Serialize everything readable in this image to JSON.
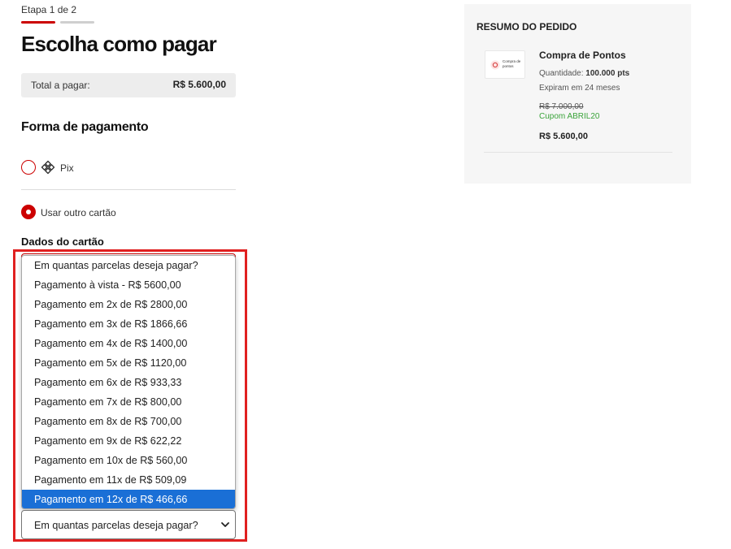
{
  "header": {
    "step_label": "Etapa 1 de 2",
    "steps_completed": 1,
    "steps_total": 2,
    "title": "Escolha como pagar"
  },
  "total": {
    "label": "Total a pagar:",
    "value": "R$ 5.600,00"
  },
  "payment": {
    "section_title": "Forma de pagamento",
    "options": [
      {
        "label": "Pix",
        "icon": "pix-icon",
        "checked": false
      },
      {
        "label": "Usar outro cartão",
        "checked": true
      }
    ]
  },
  "card": {
    "section_title": "Dados do cartão",
    "installments": {
      "placeholder": "Em quantas parcelas deseja pagar?",
      "selected_value": "Em quantas parcelas deseja pagar?",
      "highlighted_index": 12,
      "options": [
        "Em quantas parcelas deseja pagar?",
        "Pagamento à vista - R$ 5600,00",
        "Pagamento em 2x de R$ 2800,00",
        "Pagamento em 3x de R$ 1866,66",
        "Pagamento em 4x de R$ 1400,00",
        "Pagamento em 5x de R$ 1120,00",
        "Pagamento em 6x de R$ 933,33",
        "Pagamento em 7x de R$ 800,00",
        "Pagamento em 8x de R$ 700,00",
        "Pagamento em 9x de R$ 622,22",
        "Pagamento em 10x de R$ 560,00",
        "Pagamento em 11x de R$ 509,09",
        "Pagamento em 12x de R$ 466,66"
      ]
    }
  },
  "summary": {
    "title": "RESUMO DO PEDIDO",
    "product": {
      "name": "Compra de Pontos",
      "thumb_text": "Compra de pontos",
      "quantity_label": "Quantidade:",
      "quantity_value": "100.000 pts",
      "expiry": "Expiram em 24 meses",
      "old_price": "R$ 7.000,00",
      "coupon": "Cupom ABRIL20",
      "price": "R$ 5.600,00"
    }
  },
  "colors": {
    "accent": "#cc0000",
    "highlight_border": "#e02020",
    "selected_option": "#1a6fd6",
    "coupon": "#3aa33a"
  }
}
